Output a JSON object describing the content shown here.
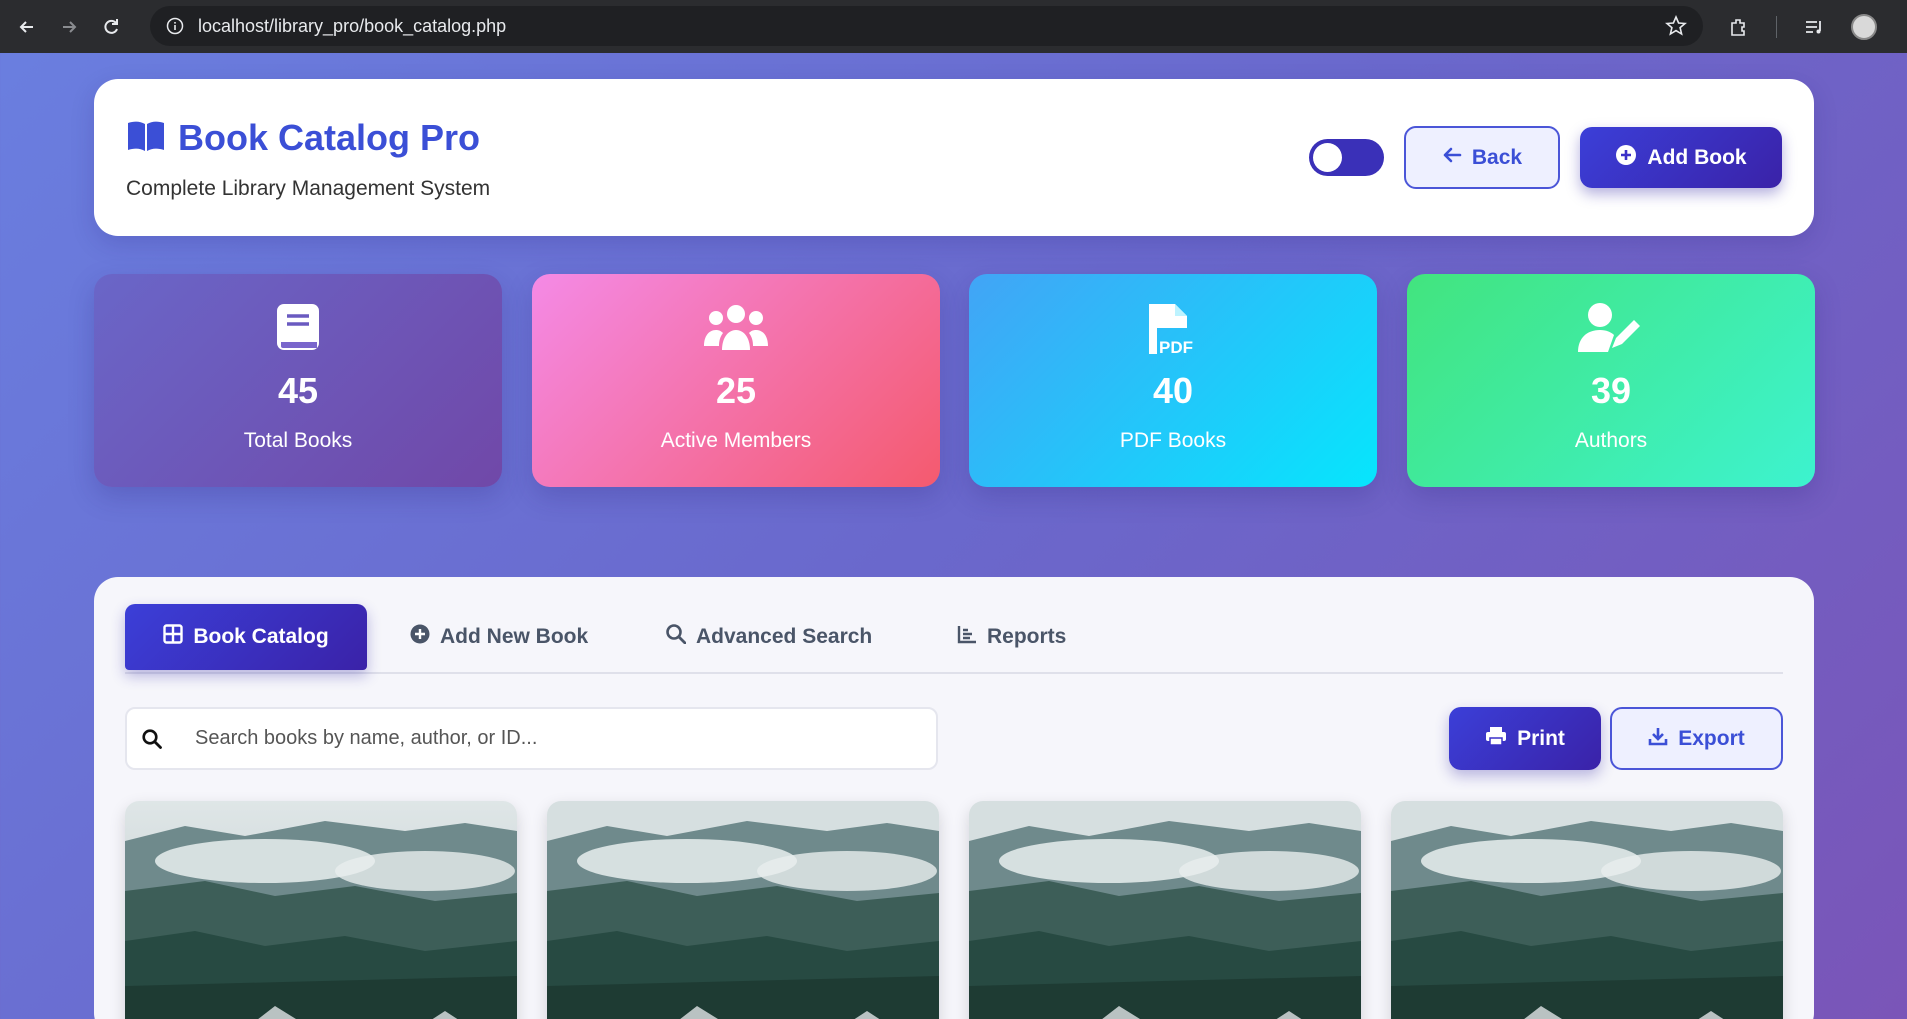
{
  "browser": {
    "url": "localhost/library_pro/book_catalog.php"
  },
  "header": {
    "title": "Book Catalog Pro",
    "subtitle": "Complete Library Management System",
    "back_label": "Back",
    "add_label": "Add Book",
    "theme_toggle_on": false
  },
  "stats": [
    {
      "value": "45",
      "label": "Total Books",
      "icon": "book-icon"
    },
    {
      "value": "25",
      "label": "Active Members",
      "icon": "users-icon"
    },
    {
      "value": "40",
      "label": "PDF Books",
      "icon": "pdf-file-icon"
    },
    {
      "value": "39",
      "label": "Authors",
      "icon": "user-edit-icon"
    }
  ],
  "tabs": [
    {
      "label": "Book Catalog",
      "active": true
    },
    {
      "label": "Add New Book",
      "active": false
    },
    {
      "label": "Advanced Search",
      "active": false
    },
    {
      "label": "Reports",
      "active": false
    }
  ],
  "search": {
    "placeholder": "Search books by name, author, or ID..."
  },
  "actions": {
    "print_label": "Print",
    "export_label": "Export"
  },
  "colors": {
    "accent": "#3b4fd6",
    "accent_dark": "#3a22a8"
  }
}
